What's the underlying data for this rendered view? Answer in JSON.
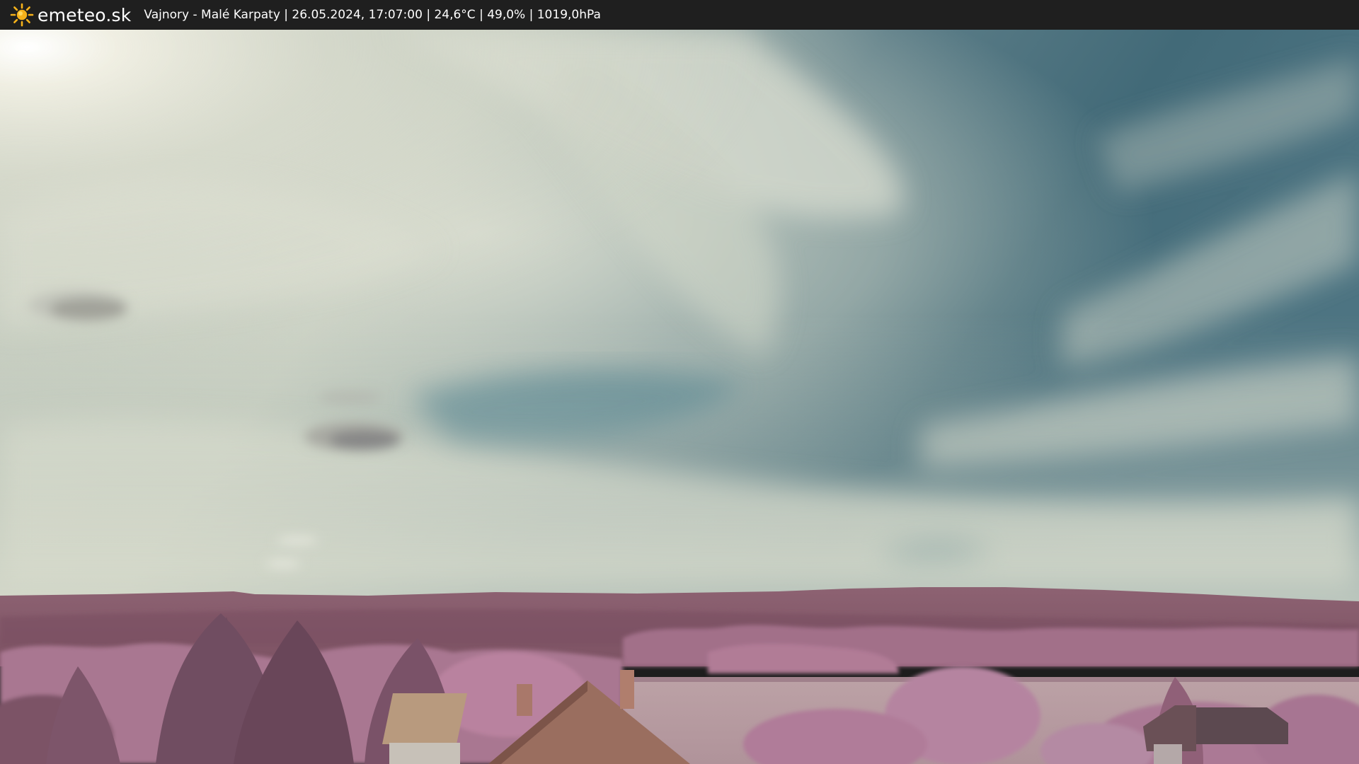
{
  "header": {
    "brand": "emeteo.sk",
    "logo_icon": "sun-icon",
    "caption": "Vajnory - Malé Karpaty | 26.05.2024, 17:07:00 | 24,6°C | 49,0% | 1019,0hPa"
  },
  "colors": {
    "bar": "#1f1f1f",
    "sun": "#f7b21a",
    "sky_blue": "#3f6e7e",
    "cloud": "#d7dccf",
    "foliage": "#a8768f",
    "hills": "#8a5a6c"
  }
}
